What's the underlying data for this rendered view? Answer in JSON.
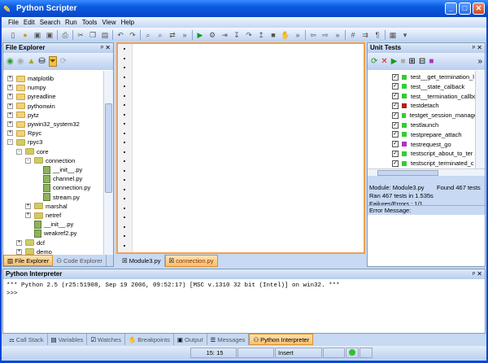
{
  "window": {
    "title": "Python Scripter",
    "min": "_",
    "max": "□",
    "close": "✕"
  },
  "menu": [
    "File",
    "Edit",
    "Search",
    "Run",
    "Tools",
    "View",
    "Help"
  ],
  "file_explorer": {
    "title": "File Explorer",
    "pin": "ᵖ ✕",
    "tree": [
      {
        "label": "matplotlib",
        "depth": 0,
        "type": "folder",
        "exp": "+"
      },
      {
        "label": "numpy",
        "depth": 0,
        "type": "folder",
        "exp": "+"
      },
      {
        "label": "pyreadline",
        "depth": 0,
        "type": "folder",
        "exp": "+"
      },
      {
        "label": "pythonwin",
        "depth": 0,
        "type": "folder",
        "exp": "+"
      },
      {
        "label": "pytz",
        "depth": 0,
        "type": "folder",
        "exp": "+"
      },
      {
        "label": "pywin32_system32",
        "depth": 0,
        "type": "folder",
        "exp": "+"
      },
      {
        "label": "Rpyc",
        "depth": 0,
        "type": "folder",
        "exp": "+"
      },
      {
        "label": "rpyc3",
        "depth": 0,
        "type": "pkg",
        "exp": "-"
      },
      {
        "label": "core",
        "depth": 1,
        "type": "pkg",
        "exp": "-"
      },
      {
        "label": "connection",
        "depth": 2,
        "type": "pkg",
        "exp": "-"
      },
      {
        "label": "__init__.py",
        "depth": 3,
        "type": "file"
      },
      {
        "label": "channel.py",
        "depth": 3,
        "type": "file"
      },
      {
        "label": "connection.py",
        "depth": 3,
        "type": "file"
      },
      {
        "label": "stream.py",
        "depth": 3,
        "type": "file"
      },
      {
        "label": "marshal",
        "depth": 2,
        "type": "pkg",
        "exp": "+"
      },
      {
        "label": "netref",
        "depth": 2,
        "type": "pkg",
        "exp": "+"
      },
      {
        "label": "__init__.py",
        "depth": 2,
        "type": "file"
      },
      {
        "label": "weakref2.py",
        "depth": 2,
        "type": "file"
      },
      {
        "label": "dcf",
        "depth": 1,
        "type": "pkg",
        "exp": "+"
      },
      {
        "label": "demo",
        "depth": 1,
        "type": "pkg",
        "exp": "+"
      }
    ],
    "tabs": [
      "File Explorer",
      "Code Explorer"
    ]
  },
  "editor": {
    "tabs": [
      "Module3.py",
      "connection.py"
    ]
  },
  "unit_tests": {
    "title": "Unit Tests",
    "pin": "ᵖ ✕",
    "tests": [
      {
        "name": "test__get_termination_l",
        "status": "#33cc33"
      },
      {
        "name": "test__state_calback",
        "status": "#33cc33"
      },
      {
        "name": "test__termination_callbc",
        "status": "#33cc33"
      },
      {
        "name": "testdetach",
        "status": "#b02020"
      },
      {
        "name": "testget_session_manage",
        "status": "#33cc33"
      },
      {
        "name": "testlaunch",
        "status": "#33cc33"
      },
      {
        "name": "testprepare_attach",
        "status": "#33cc33"
      },
      {
        "name": "testrequest_go",
        "status": "#b030c0"
      },
      {
        "name": "testscript_about_to_ter",
        "status": "#33cc33"
      },
      {
        "name": "testscript_terminated_c",
        "status": "#33cc33"
      }
    ],
    "module": "Module: Module3.py",
    "found": "Found 467 tests",
    "ran": "Ran 467 tests in 1.535s",
    "failures": "Failures/Errors : 1/1",
    "error_label": "Error Message:"
  },
  "interpreter": {
    "title": "Python Interpreter",
    "lines": "*** Python 2.5 (r25:51908, Sep 19 2006, 09:52:17) [MSC v.1310 32 bit (Intel)] on win32. ***\n>>>"
  },
  "bottom_tabs": [
    "Call Stack",
    "Variables",
    "Watches",
    "Breakpoints",
    "Output",
    "Messages",
    "Python Interpreter"
  ],
  "status": {
    "position": "15: 15",
    "mode": "Insert"
  }
}
